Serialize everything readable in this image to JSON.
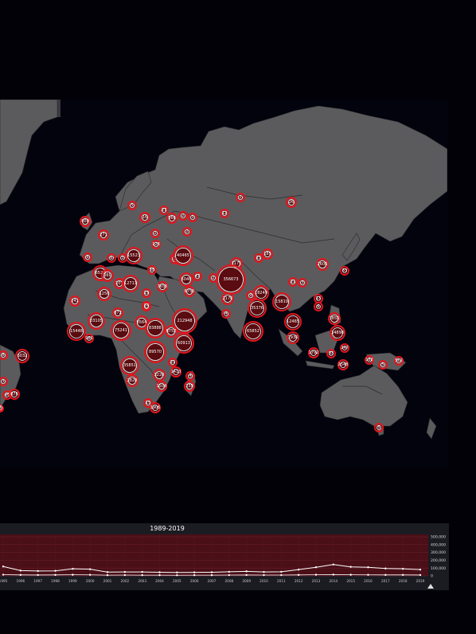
{
  "map": {
    "markers": [
      {
        "label": "8"
      },
      {
        "label": "6032"
      },
      {
        "label": "3"
      },
      {
        "label": "1"
      },
      {
        "label": "46"
      },
      {
        "label": "876"
      },
      {
        "label": "4"
      },
      {
        "label": "800"
      },
      {
        "label": "271"
      },
      {
        "label": "5"
      },
      {
        "label": "16"
      },
      {
        "label": "27"
      },
      {
        "label": "566"
      },
      {
        "label": "2"
      },
      {
        "label": "3"
      },
      {
        "label": "12"
      },
      {
        "label": "2"
      },
      {
        "label": "2"
      },
      {
        "label": "26"
      },
      {
        "label": "2"
      },
      {
        "label": "8"
      },
      {
        "label": "15523"
      },
      {
        "label": "32"
      },
      {
        "label": "40465"
      },
      {
        "label": "128"
      },
      {
        "label": "3"
      },
      {
        "label": "6"
      },
      {
        "label": "6528"
      },
      {
        "label": "660"
      },
      {
        "label": "58"
      },
      {
        "label": "1171"
      },
      {
        "label": "21"
      },
      {
        "label": "185"
      },
      {
        "label": "2606"
      },
      {
        "label": "63"
      },
      {
        "label": "107"
      },
      {
        "label": "12711"
      },
      {
        "label": "5048"
      },
      {
        "label": "47"
      },
      {
        "label": "7655"
      },
      {
        "label": "6755"
      },
      {
        "label": "19"
      },
      {
        "label": "2"
      },
      {
        "label": "356673"
      },
      {
        "label": "18249"
      },
      {
        "label": "21"
      },
      {
        "label": "3"
      },
      {
        "label": "1256"
      },
      {
        "label": "19"
      },
      {
        "label": "2176"
      },
      {
        "label": "9"
      },
      {
        "label": "15819"
      },
      {
        "label": "13"
      },
      {
        "label": "241"
      },
      {
        "label": "24"
      },
      {
        "label": "672"
      },
      {
        "label": "4"
      },
      {
        "label": "35376"
      },
      {
        "label": "6"
      },
      {
        "label": "3855"
      },
      {
        "label": "33105"
      },
      {
        "label": "8564"
      },
      {
        "label": "212948"
      },
      {
        "label": "12465"
      },
      {
        "label": "15448"
      },
      {
        "label": "75241"
      },
      {
        "label": "83888"
      },
      {
        "label": "6752"
      },
      {
        "label": "65852"
      },
      {
        "label": "34898"
      },
      {
        "label": "986"
      },
      {
        "label": "60913"
      },
      {
        "label": "7936"
      },
      {
        "label": "247"
      },
      {
        "label": "1792"
      },
      {
        "label": "33"
      },
      {
        "label": "182"
      },
      {
        "label": "89570"
      },
      {
        "label": "2548"
      },
      {
        "label": "5"
      },
      {
        "label": "562"
      },
      {
        "label": "21"
      },
      {
        "label": "35851"
      },
      {
        "label": "3220"
      },
      {
        "label": "1413"
      },
      {
        "label": "4"
      },
      {
        "label": "2820"
      },
      {
        "label": "1504"
      },
      {
        "label": "239"
      },
      {
        "label": "15"
      },
      {
        "label": "1906"
      },
      {
        "label": "5"
      }
    ]
  },
  "timeline": {
    "title": "1989-2019",
    "x_labels": [
      "1995",
      "1996",
      "1997",
      "1998",
      "1999",
      "2000",
      "2001",
      "2002",
      "2003",
      "2004",
      "2005",
      "2006",
      "2007",
      "2008",
      "2009",
      "2010",
      "2011",
      "2012",
      "2013",
      "2014",
      "2015",
      "2016",
      "2017",
      "2018",
      "2019"
    ],
    "y_labels": [
      "500,000",
      "400,000",
      "300,000",
      "200,000",
      "100,000",
      "0"
    ],
    "series_a": [
      120000,
      68000,
      62000,
      64000,
      90000,
      85000,
      48000,
      50000,
      50000,
      46000,
      44000,
      45000,
      46000,
      52000,
      58000,
      50000,
      52000,
      80000,
      110000,
      145000,
      115000,
      110000,
      95000,
      90000,
      80000
    ],
    "series_b": [
      15000,
      12000,
      11000,
      12000,
      14000,
      13000,
      9000,
      10000,
      9000,
      9000,
      8000,
      9000,
      9000,
      10000,
      11000,
      10000,
      10000,
      12000,
      14000,
      16000,
      14000,
      13000,
      12000,
      12000,
      11000
    ]
  }
}
